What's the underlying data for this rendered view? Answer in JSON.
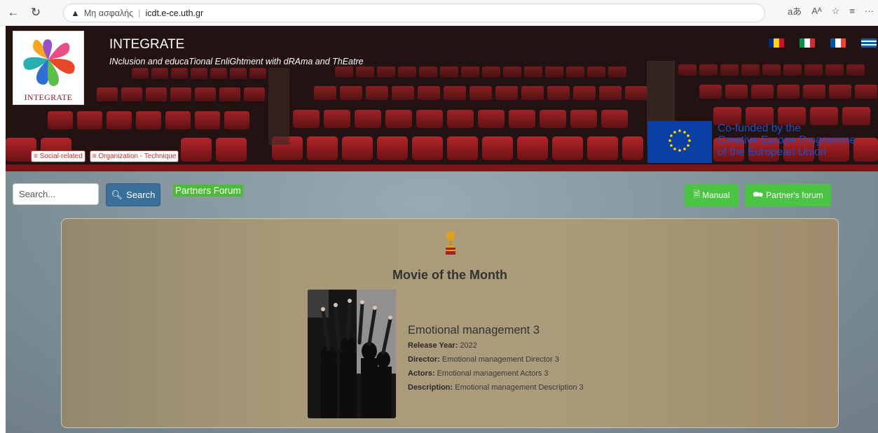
{
  "browser": {
    "security_label": "Μη ασφαλής",
    "url": "icdt.e-ce.uth.gr"
  },
  "header": {
    "logo_text": "INTEGRATE",
    "title": "INTEGRATE",
    "subtitle": "INclusion and educaTional EnliGhtment with dRAma and ThEatre",
    "flags": [
      {
        "name": "romania",
        "colors": [
          "#002b7f",
          "#fcd116",
          "#ce1126"
        ]
      },
      {
        "name": "italy",
        "colors": [
          "#009246",
          "#ffffff",
          "#ce2b37"
        ]
      },
      {
        "name": "france",
        "colors": [
          "#0055a4",
          "#ffffff",
          "#ef4135"
        ]
      },
      {
        "name": "greece",
        "colors": [
          "#0d5eaf",
          "#ffffff"
        ]
      }
    ],
    "tags": [
      "≡ Social-related",
      "≡ Organization - Technique"
    ],
    "eu_text": [
      "Co-funded by the",
      "Creative Europe Programme",
      "of the European Union"
    ]
  },
  "toolbar": {
    "search_placeholder": "Search...",
    "search_label": "Search",
    "forum_link": "Partners Forum",
    "manual_label": "Manual",
    "partner_forum_label": "Partner's forum"
  },
  "movie": {
    "heading": "Movie of the Month",
    "title": "Emotional management 3",
    "release_label": "Release Year:",
    "release_year": "2022",
    "director_label": "Director:",
    "director": "Emotional management Director 3",
    "actors_label": "Actors:",
    "actors": "Emotional management Actors 3",
    "description_label": "Description:",
    "description": "Emotional management Description 3"
  },
  "colors": {
    "accent_green": "#4cc443",
    "search_blue": "#3a6f9a",
    "tag_red": "#c0302c",
    "eu_blue": "#0b3fa4"
  }
}
